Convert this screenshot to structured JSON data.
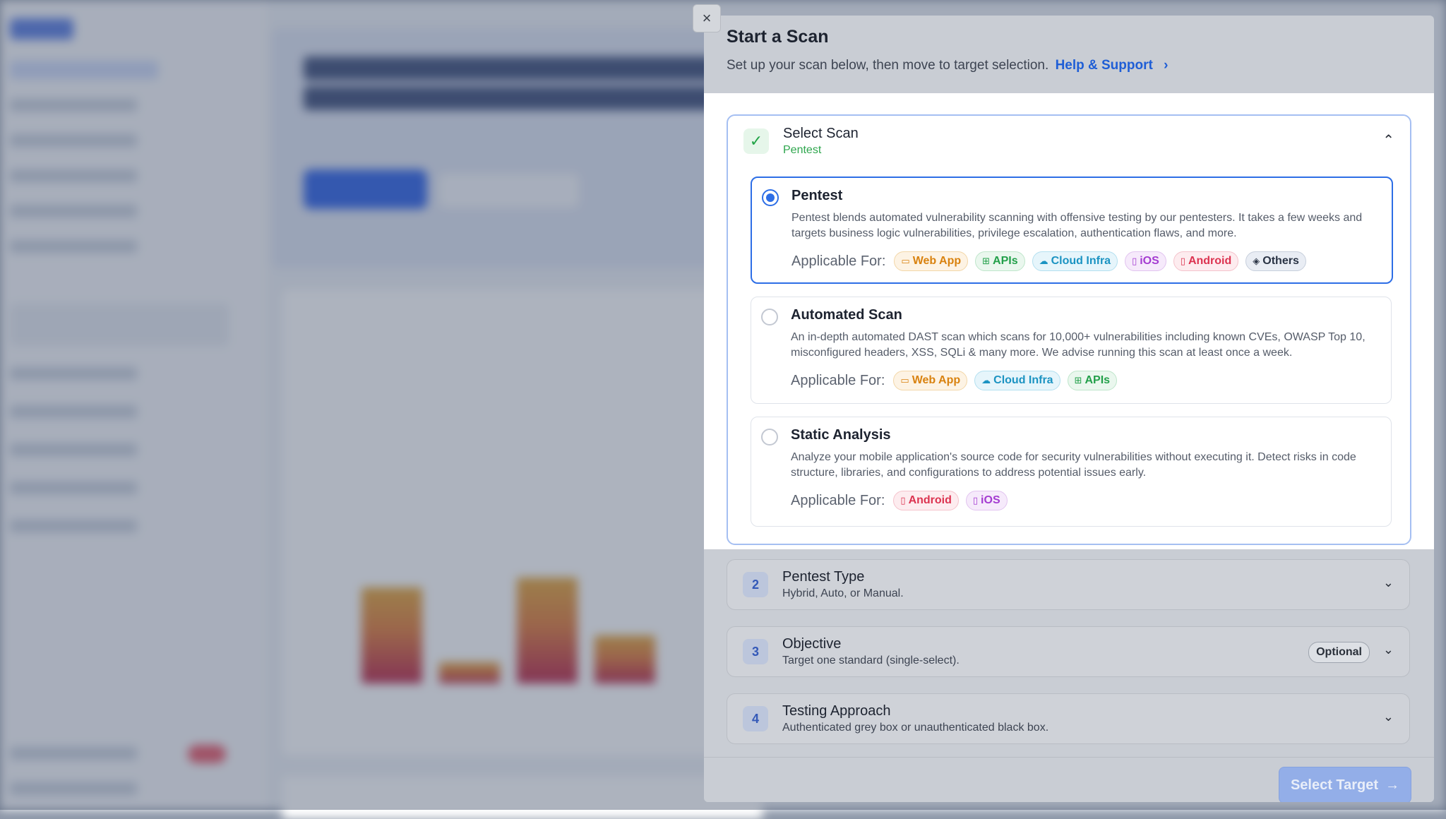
{
  "modal": {
    "title": "Start a Scan",
    "subtitle": "Set up your scan below, then move to target selection.",
    "help_link": "Help & Support",
    "close_icon": "×"
  },
  "select_scan": {
    "title": "Select Scan",
    "selected": "Pentest",
    "options": [
      {
        "title": "Pentest",
        "selected": true,
        "description": "Pentest blends automated vulnerability scanning with offensive testing by our pentesters. It takes a few weeks and targets business logic vulnerabilities, privilege escalation, authentication flaws, and more.",
        "applicable_label": "Applicable For:",
        "tags": [
          "Web App",
          "APIs",
          "Cloud Infra",
          "iOS",
          "Android",
          "Others"
        ]
      },
      {
        "title": "Automated Scan",
        "selected": false,
        "description": "An in-depth automated DAST scan which scans for 10,000+ vulnerabilities including known CVEs, OWASP Top 10, misconfigured headers, XSS, SQLi & many more. We advise running this scan at least once a week.",
        "applicable_label": "Applicable For:",
        "tags": [
          "Web App",
          "Cloud Infra",
          "APIs"
        ]
      },
      {
        "title": "Static Analysis",
        "selected": false,
        "description": "Analyze your mobile application's source code for security vulnerabilities without executing it. Detect risks in code structure, libraries, and configurations to address potential issues early.",
        "applicable_label": "Applicable For:",
        "tags": [
          "Android",
          "iOS"
        ]
      }
    ]
  },
  "steps": [
    {
      "number": "2",
      "title": "Pentest Type",
      "subtitle": "Hybrid, Auto, or Manual."
    },
    {
      "number": "3",
      "title": "Objective",
      "subtitle": "Target one standard (single-select).",
      "badge": "Optional"
    },
    {
      "number": "4",
      "title": "Testing Approach",
      "subtitle": "Authenticated grey box or unauthenticated black box."
    }
  ],
  "footer": {
    "select_target_label": "Select Target"
  },
  "colors": {
    "accent": "#2d6ee6",
    "link": "#1f5ed6",
    "success": "#2ea64d"
  }
}
